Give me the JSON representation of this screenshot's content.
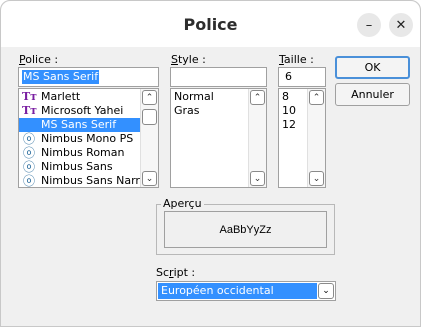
{
  "window": {
    "title": "Police"
  },
  "titlebar": {
    "minimize_glyph": "–",
    "close_glyph": "✕"
  },
  "font": {
    "label": "Police :",
    "label_key": "P",
    "label_rest": "olice :",
    "value": "MS Sans Serif",
    "items": [
      {
        "name": "Marlett",
        "icon": "truetype-icon",
        "selected": false
      },
      {
        "name": "Microsoft Yahei",
        "icon": "truetype-icon",
        "selected": false
      },
      {
        "name": "MS Sans Serif",
        "icon": "none",
        "selected": true
      },
      {
        "name": "Nimbus Mono PS",
        "icon": "opentype-icon",
        "selected": false
      },
      {
        "name": "Nimbus Roman",
        "icon": "opentype-icon",
        "selected": false
      },
      {
        "name": "Nimbus Sans",
        "icon": "opentype-icon",
        "selected": false
      },
      {
        "name": "Nimbus Sans Narrow",
        "icon": "opentype-icon",
        "selected": false
      }
    ]
  },
  "style": {
    "label": "Style :",
    "label_key": "S",
    "label_rest": "tyle :",
    "value": "",
    "items": [
      "Normal",
      "Gras"
    ]
  },
  "size": {
    "label": "Taille :",
    "label_key": "T",
    "label_rest": "aille :",
    "value": "6",
    "items": [
      "8",
      "10",
      "12"
    ]
  },
  "buttons": {
    "ok": "OK",
    "cancel": "Annuler"
  },
  "preview": {
    "group_label": "Aperçu",
    "sample": "AaBbYyZz"
  },
  "script": {
    "label": "Script :",
    "label_key": "r",
    "label_pre": "Sc",
    "label_rest": "ipt :",
    "value": "Européen occidental"
  },
  "colors": {
    "selection": "#3390ff",
    "default_button_border": "#4a90d9"
  }
}
